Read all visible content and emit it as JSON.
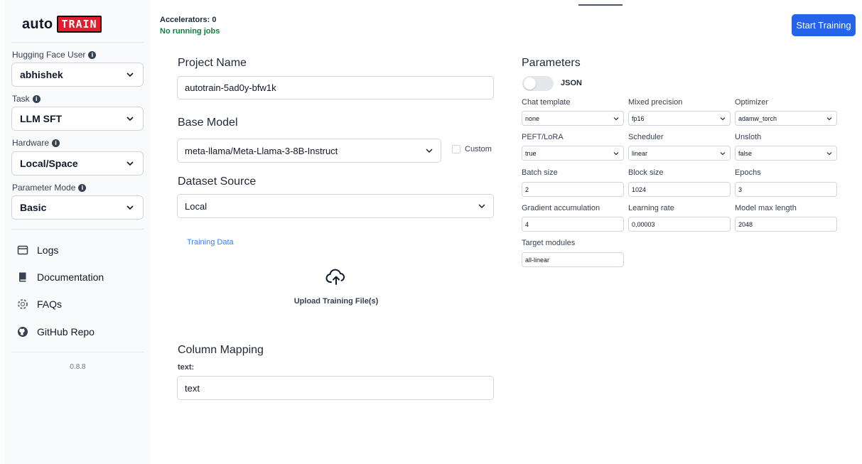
{
  "logo": {
    "auto": "auto",
    "train": "TRAIN"
  },
  "sidebar": {
    "user_label": "Hugging Face User",
    "user_value": "abhishek",
    "task_label": "Task",
    "task_value": "LLM SFT",
    "hardware_label": "Hardware",
    "hardware_value": "Local/Space",
    "mode_label": "Parameter Mode",
    "mode_value": "Basic",
    "links": [
      {
        "label": "Logs",
        "icon": "logs-icon"
      },
      {
        "label": "Documentation",
        "icon": "book-icon"
      },
      {
        "label": "FAQs",
        "icon": "lifebuoy-icon"
      },
      {
        "label": "GitHub Repo",
        "icon": "github-icon"
      }
    ],
    "version": "0.8.8"
  },
  "header": {
    "accelerators": "Accelerators: 0",
    "jobs": "No running jobs",
    "start_button": "Start Training"
  },
  "main": {
    "project_name_heading": "Project Name",
    "project_name_value": "autotrain-5ad0y-bfw1k",
    "base_model_heading": "Base Model",
    "base_model_value": "meta-llama/Meta-Llama-3-8B-Instruct",
    "custom_label": "Custom",
    "dataset_source_heading": "Dataset Source",
    "dataset_source_value": "Local",
    "training_data_label": "Training Data",
    "upload_label": "Upload Training File(s)",
    "column_mapping_heading": "Column Mapping",
    "text_label": "text:",
    "text_value": "text"
  },
  "parameters": {
    "heading": "Parameters",
    "json_label": "JSON",
    "json_enabled": false,
    "chat_template": {
      "label": "Chat template",
      "value": "none"
    },
    "mixed_precision": {
      "label": "Mixed precision",
      "value": "fp16"
    },
    "optimizer": {
      "label": "Optimizer",
      "value": "adamw_torch"
    },
    "peft": {
      "label": "PEFT/LoRA",
      "value": "true"
    },
    "scheduler": {
      "label": "Scheduler",
      "value": "linear"
    },
    "unsloth": {
      "label": "Unsloth",
      "value": "false"
    },
    "batch_size": {
      "label": "Batch size",
      "value": "2"
    },
    "block_size": {
      "label": "Block size",
      "value": "1024"
    },
    "epochs": {
      "label": "Epochs",
      "value": "3"
    },
    "grad_accum": {
      "label": "Gradient accumulation",
      "value": "4"
    },
    "learning_rate": {
      "label": "Learning rate",
      "value": "0,00003"
    },
    "model_max_length": {
      "label": "Model max length",
      "value": "2048"
    },
    "target_modules": {
      "label": "Target modules",
      "value": "all-linear"
    }
  },
  "colors": {
    "primary": "#2563eb",
    "success": "#15803d",
    "link": "#3b82f6",
    "logo_red": "#e11d2e"
  }
}
